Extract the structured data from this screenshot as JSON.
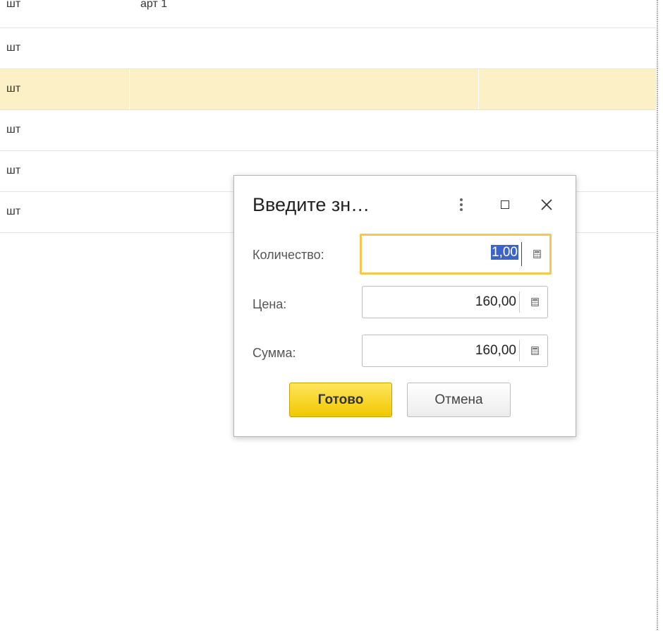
{
  "table": {
    "rows": [
      {
        "unit": "шт",
        "name": "арт 1"
      },
      {
        "unit": "шт",
        "name": ""
      },
      {
        "unit": "шт",
        "name": ""
      },
      {
        "unit": "шт",
        "name": ""
      },
      {
        "unit": "шт",
        "name": ""
      },
      {
        "unit": "шт",
        "name": ""
      }
    ],
    "selected_row_index": 2,
    "selection_color": "#fbf0c6"
  },
  "dialog": {
    "title": "Введите зн…",
    "icons": {
      "menu": "more-vertical-icon",
      "maximize": "maximize-icon",
      "close": "close-icon"
    },
    "fields": {
      "quantity": {
        "label": "Количество:",
        "value": "1,00"
      },
      "price": {
        "label": "Цена:",
        "value": "160,00"
      },
      "sum": {
        "label": "Сумма:",
        "value": "160,00"
      }
    },
    "buttons": {
      "ok": "Готово",
      "cancel": "Отмена"
    },
    "colors": {
      "focus_border": "#f2c94c",
      "ok_button": "#f5d20a",
      "selection": "#3a64c8"
    }
  }
}
